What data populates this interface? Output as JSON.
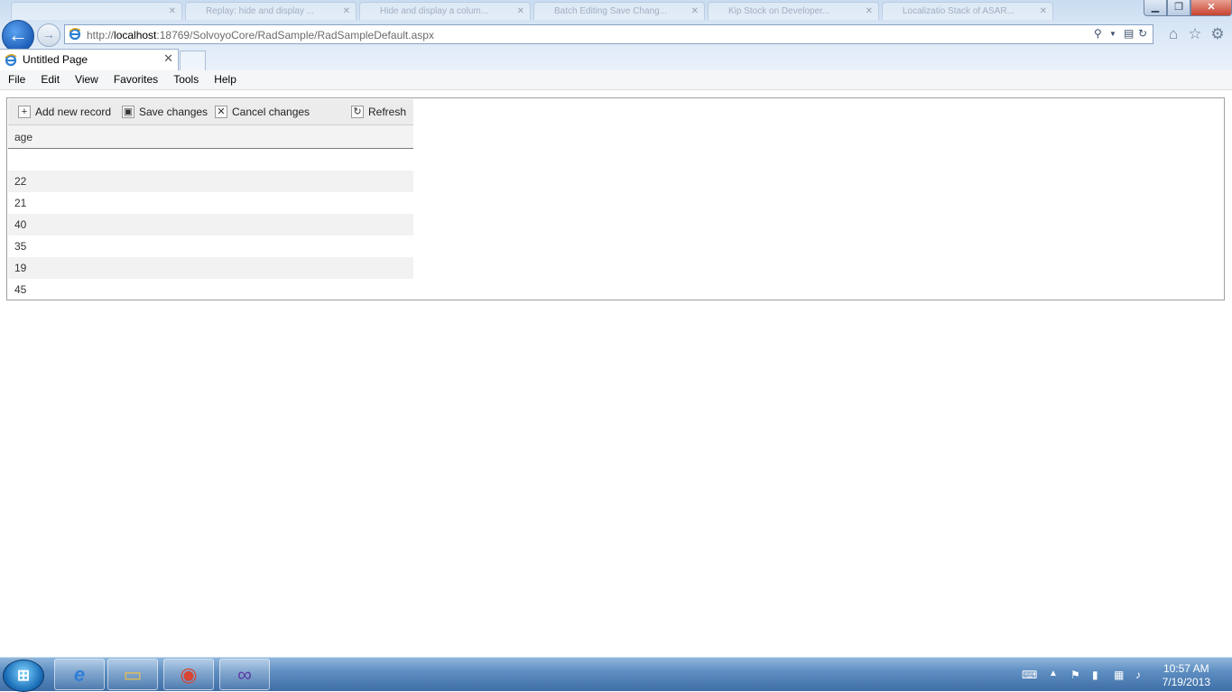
{
  "browser": {
    "tab_title": "Untitled Page",
    "address_scheme": "http://",
    "address_host": "localhost",
    "address_path": ":18769/SolvoyoCore/RadSample/RadSampleDefault.aspx",
    "background_tabs": [
      "",
      "Replay: hide and display ...",
      "Hide and display a colum...",
      "Batch Editing Save Chang...",
      "Kip Stock on Developer...",
      "Localizatio Stack of ASAR..."
    ],
    "menu": [
      "File",
      "Edit",
      "View",
      "Favorites",
      "Tools",
      "Help"
    ]
  },
  "grid": {
    "toolbar": {
      "add": "Add new record",
      "save": "Save changes",
      "cancel": "Cancel changes",
      "refresh": "Refresh"
    },
    "column_header": "age",
    "rows": [
      "",
      "22",
      "21",
      "40",
      "35",
      "19",
      "45"
    ]
  },
  "taskbar": {
    "time": "10:57 AM",
    "date": "7/19/2013",
    "apps": [
      "internet-explorer-icon",
      "file-explorer-icon",
      "chrome-icon",
      "visual-studio-icon"
    ]
  },
  "colors": {
    "accent": "#1e5fb8",
    "grid_alt_row": "#f2f2f2",
    "toolbar_bg": "#ececec"
  }
}
